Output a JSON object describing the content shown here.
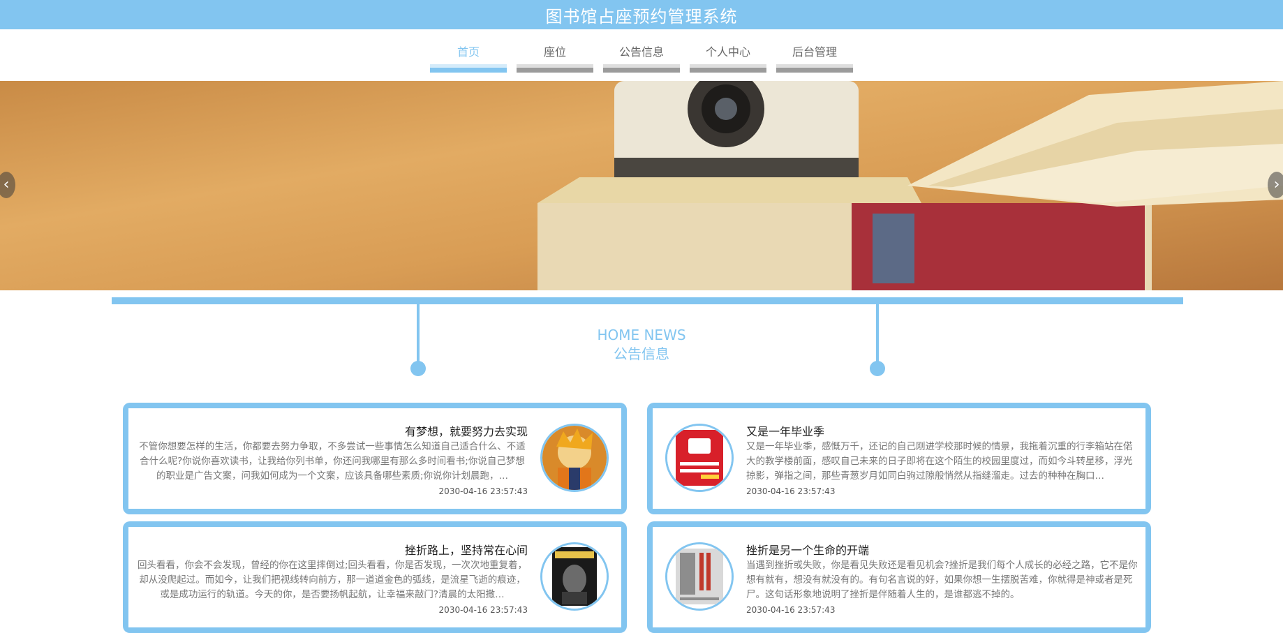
{
  "header": {
    "title": "图书馆占座预约管理系统"
  },
  "nav": {
    "items": [
      {
        "label": "首页",
        "active": true
      },
      {
        "label": "座位",
        "active": false
      },
      {
        "label": "公告信息",
        "active": false
      },
      {
        "label": "个人中心",
        "active": false
      },
      {
        "label": "后台管理",
        "active": false
      }
    ]
  },
  "banner": {
    "prev_icon": "chevron-left-icon",
    "next_icon": "chevron-right-icon"
  },
  "section": {
    "title_en": "HOME NEWS",
    "title_cn": "公告信息"
  },
  "news": [
    {
      "title": "有梦想，就要努力去实现",
      "excerpt": "不管你想要怎样的生活，你都要去努力争取，不多尝试一些事情怎么知道自己适合什么、不适合什么呢?你说你喜欢读书，让我给你列书单，你还问我哪里有那么多时间看书;你说自己梦想的职业是广告文案，问我如何成为一个文案，应该具备哪些素质;你说你计划晨跑，…",
      "date": "2030-04-16 23:57:43"
    },
    {
      "title": "又是一年毕业季",
      "excerpt": "又是一年毕业季，感慨万千，还记的自己刚进学校那时候的情景，我拖着沉重的行李箱站在偌大的教学楼前面，感叹自己未来的日子即将在这个陌生的校园里度过，而如今斗转星移，浮光掠影，弹指之间，那些青葱岁月如同白驹过隙般悄然从指缝溜走。过去的种种在胸口…",
      "date": "2030-04-16 23:57:43"
    },
    {
      "title": "挫折路上，坚持常在心间",
      "excerpt": "回头看看，你会不会发现，曾经的你在这里摔倒过;回头看看，你是否发现，一次次地重复着，却从没爬起过。而如今，让我们把视线转向前方，那一道道金色的弧线，是流星飞逝的痕迹，或是成功运行的轨道。今天的你，是否要扬帆起航，让幸福来敲门?清晨的太阳撒…",
      "date": "2030-04-16 23:57:43"
    },
    {
      "title": "挫折是另一个生命的开端",
      "excerpt": "当遇到挫折或失败，你是看见失败还是看见机会?挫折是我们每个人成长的必经之路，它不是你想有就有，想没有就没有的。有句名言说的好，如果你想一生摆脱苦难，你就得是神或者是死尸。这句话形象地说明了挫折是伴随着人生的，是谁都逃不掉的。",
      "date": "2030-04-16 23:57:43"
    }
  ],
  "colors": {
    "accent": "#82c5f0",
    "text": "#222222",
    "muted": "#777777"
  }
}
